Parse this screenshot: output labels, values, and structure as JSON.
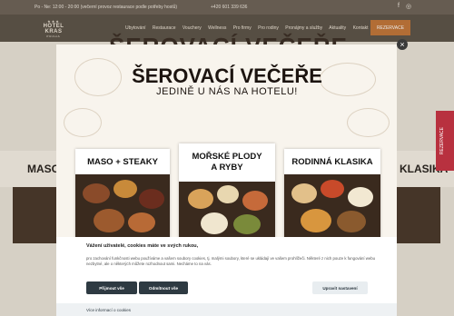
{
  "topbar": {
    "hours": "Po - Ne: 12:00 - 20:00 (večerní provoz restaurace podle potřeby hostů)",
    "phone": "+420 601 339 636",
    "facebook_icon": "f",
    "instagram_icon": "◎"
  },
  "header": {
    "logo_stars": "★★★",
    "logo_name": "HOTEL KRAS",
    "logo_city": "PRAHA",
    "nav": [
      "Ubytování",
      "Restaurace",
      "Vouchery",
      "Wellness",
      "Pro firmy",
      "Pro rodiny",
      "Pronájmy a služby",
      "Aktuality",
      "Kontakt"
    ],
    "reservation_label": "REZERVACE"
  },
  "background": {
    "title": "ŠEROVACÍ VEČEŘE",
    "left_panel": "MASO",
    "right_panel": "KLASIKA"
  },
  "side_tab": {
    "label": "REZERVACE"
  },
  "popup": {
    "title": "ŠEROVACÍ VEČEŘE",
    "subtitle": "JEDINĚ U NÁS NA HOTELU!",
    "close_icon": "×",
    "cards": [
      {
        "title_line1": "MASO + STEAKY",
        "title_line2": ""
      },
      {
        "title_line1": "MOŘSKÉ PLODY",
        "title_line2": "A RYBY"
      },
      {
        "title_line1": "RODINNÁ KLASIKA",
        "title_line2": ""
      }
    ]
  },
  "cookie": {
    "title": "Vážení uživatelé, cookies máte ve svých rukou,",
    "text": "pro zachování funkčnosti webu používáme a vašem soubory cookies, tj. malými soubory, které se ukládají ve vašem prohlížeči. Některé z nich pouze k fungování webu nezbytné, ale o některých můžete rozhodnout sami. Necháme to na vás.",
    "accept_label": "Přijmout vše",
    "reject_label": "Odmítnout vše",
    "settings_label": "Upravit nastavení",
    "more_link": "Více informací o cookies"
  },
  "colors": {
    "accent": "#c2773a",
    "side_tab": "#b8313f",
    "header": "#5e5549",
    "cookie_button": "#2e3a42"
  }
}
